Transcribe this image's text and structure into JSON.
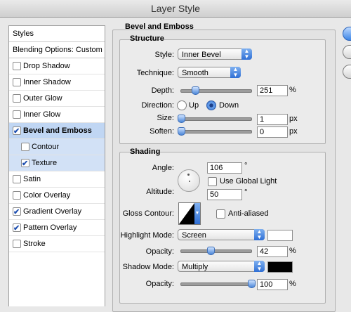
{
  "window": {
    "title": "Layer Style"
  },
  "styles_panel": {
    "header": "Styles",
    "blending": "Blending Options: Custom",
    "items": [
      {
        "label": "Drop Shadow",
        "checked": false
      },
      {
        "label": "Inner Shadow",
        "checked": false
      },
      {
        "label": "Outer Glow",
        "checked": false
      },
      {
        "label": "Inner Glow",
        "checked": false
      },
      {
        "label": "Bevel and Emboss",
        "checked": true,
        "selected": true
      },
      {
        "label": "Contour",
        "checked": false,
        "sub": true
      },
      {
        "label": "Texture",
        "checked": true,
        "sub": true
      },
      {
        "label": "Satin",
        "checked": false
      },
      {
        "label": "Color Overlay",
        "checked": false
      },
      {
        "label": "Gradient Overlay",
        "checked": true
      },
      {
        "label": "Pattern Overlay",
        "checked": true
      },
      {
        "label": "Stroke",
        "checked": false
      }
    ]
  },
  "bevel": {
    "title": "Bevel and Emboss",
    "structure": {
      "title": "Structure",
      "style_label": "Style:",
      "style_value": "Inner Bevel",
      "technique_label": "Technique:",
      "technique_value": "Smooth",
      "depth_label": "Depth:",
      "depth_value": "251",
      "depth_unit": "%",
      "depth_pos": 0.2,
      "direction_label": "Direction:",
      "dir_up": "Up",
      "dir_down": "Down",
      "direction_selected": "Down",
      "size_label": "Size:",
      "size_value": "1",
      "size_unit": "px",
      "size_pos": 0.0,
      "soften_label": "Soften:",
      "soften_value": "0",
      "soften_unit": "px",
      "soften_pos": 0.0
    },
    "shading": {
      "title": "Shading",
      "angle_label": "Angle:",
      "angle_value": "106",
      "angle_unit": "°",
      "global_light_label": "Use Global Light",
      "global_light": false,
      "altitude_label": "Altitude:",
      "altitude_value": "50",
      "altitude_unit": "°",
      "gloss_label": "Gloss Contour:",
      "antialiased_label": "Anti-aliased",
      "antialiased": false,
      "highlight_label": "Highlight Mode:",
      "highlight_value": "Screen",
      "highlight_color": "#ffffff",
      "h_opacity_label": "Opacity:",
      "h_opacity_value": "42",
      "h_opacity_unit": "%",
      "h_opacity_pos": 0.42,
      "shadow_label": "Shadow Mode:",
      "shadow_value": "Multiply",
      "shadow_color": "#000000",
      "s_opacity_label": "Opacity:",
      "s_opacity_value": "100",
      "s_opacity_unit": "%",
      "s_opacity_pos": 1.0
    }
  }
}
